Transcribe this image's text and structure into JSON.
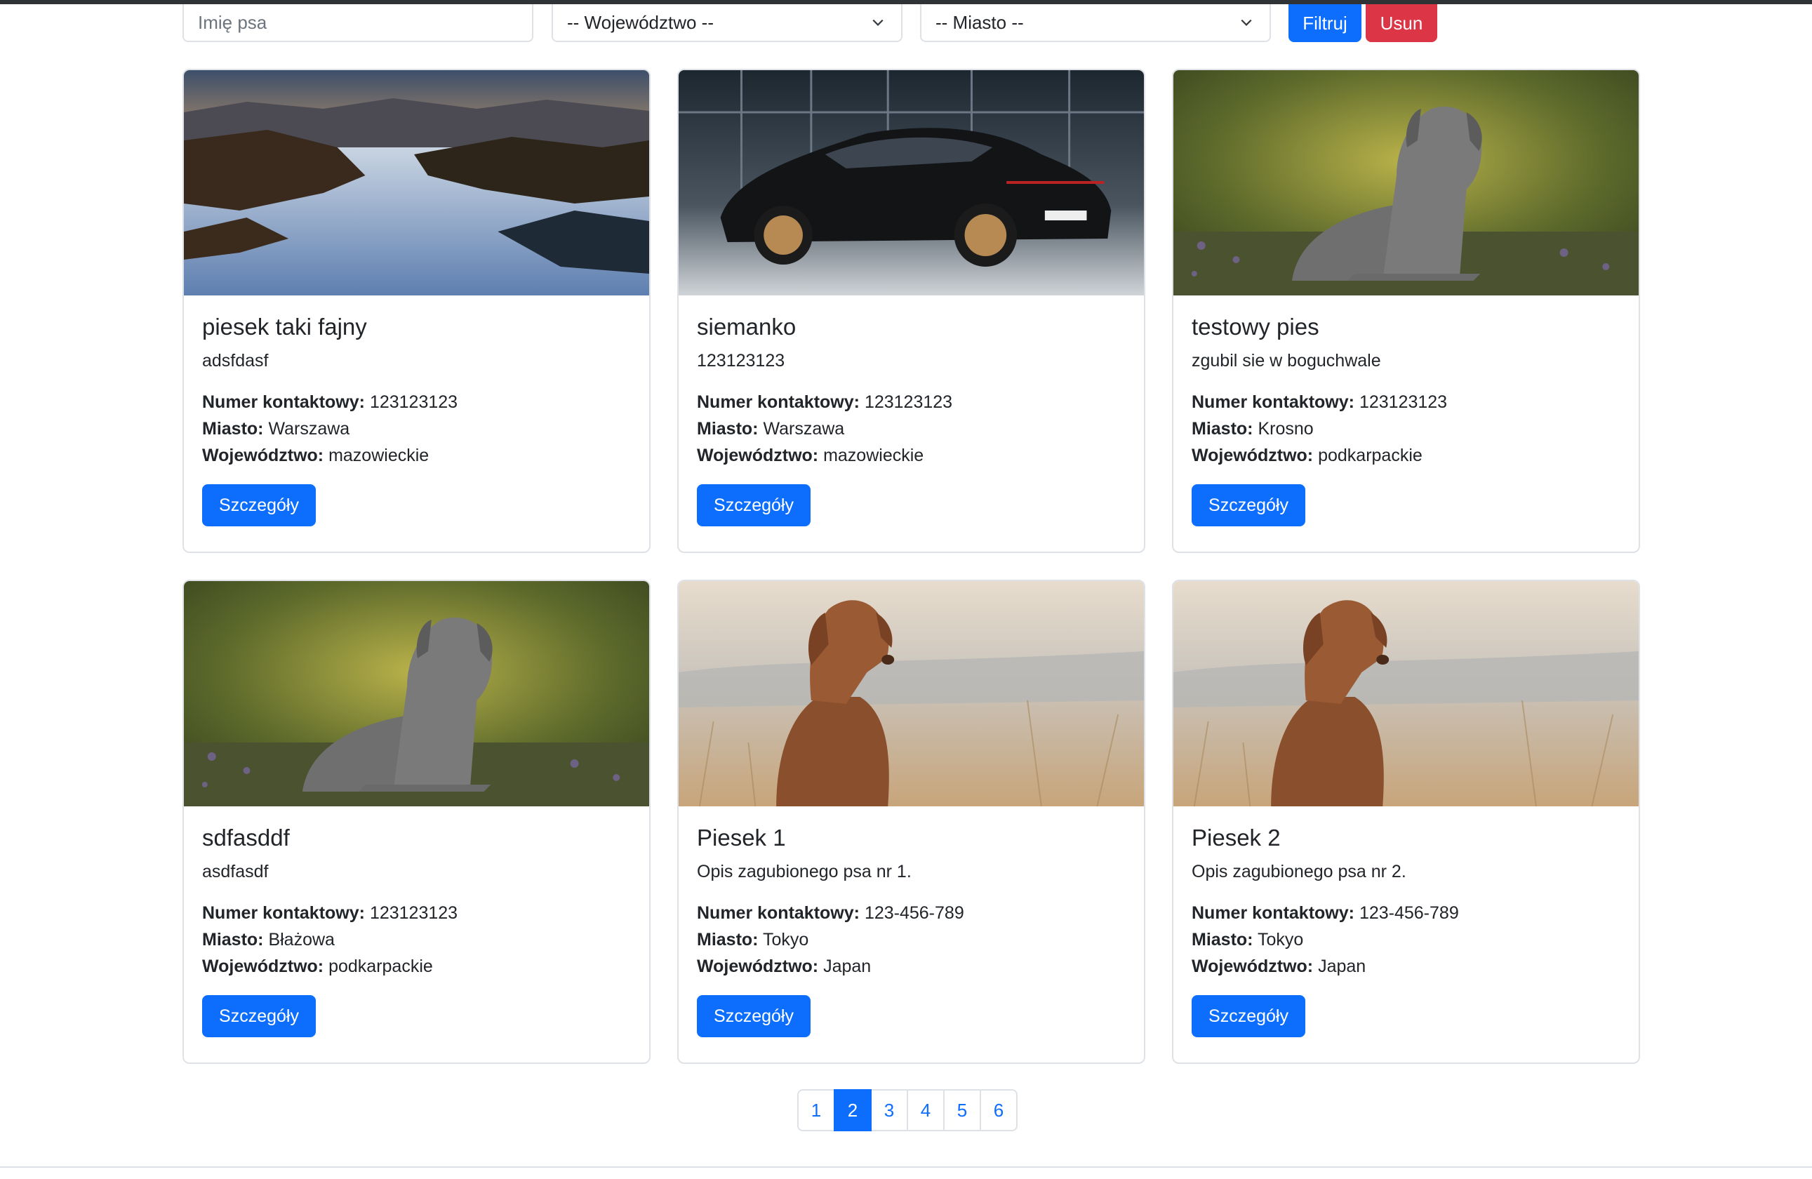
{
  "filters": {
    "name_placeholder": "Imię psa",
    "voivodeship_selected": "-- Województwo --",
    "city_selected": "-- Miasto --",
    "filter_label": "Filtruj",
    "delete_label": "Usun"
  },
  "labels": {
    "contact": "Numer kontaktowy:",
    "city": "Miasto:",
    "voivodeship": "Województwo:",
    "details": "Szczegóły"
  },
  "cards": [
    {
      "title": "piesek taki fajny",
      "desc": "adsfdasf",
      "contact": "123123123",
      "city": "Warszawa",
      "voivodeship": "mazowieckie",
      "image": "misty-mountains"
    },
    {
      "title": "siemanko",
      "desc": "123123123",
      "contact": "123123123",
      "city": "Warszawa",
      "voivodeship": "mazowieckie",
      "image": "black-sports-car"
    },
    {
      "title": "testowy pies",
      "desc": "zgubil sie w boguchwale",
      "contact": "123123123",
      "city": "Krosno",
      "voivodeship": "podkarpackie",
      "image": "grey-dog-lying"
    },
    {
      "title": "sdfasddf",
      "desc": "asdfasdf",
      "contact": "123123123",
      "city": "Błażowa",
      "voivodeship": "podkarpackie",
      "image": "grey-dog-lying"
    },
    {
      "title": "Piesek 1",
      "desc": "Opis zagubionego psa nr 1.",
      "contact": "123-456-789",
      "city": "Tokyo",
      "voivodeship": "Japan",
      "image": "brown-dog-field"
    },
    {
      "title": "Piesek 2",
      "desc": "Opis zagubionego psa nr 2.",
      "contact": "123-456-789",
      "city": "Tokyo",
      "voivodeship": "Japan",
      "image": "brown-dog-field"
    }
  ],
  "pagination": {
    "pages": [
      "1",
      "2",
      "3",
      "4",
      "5",
      "6"
    ],
    "current": "2"
  },
  "colors": {
    "primary": "#0d6efd",
    "danger": "#dc3545",
    "border": "#dee2e6"
  }
}
